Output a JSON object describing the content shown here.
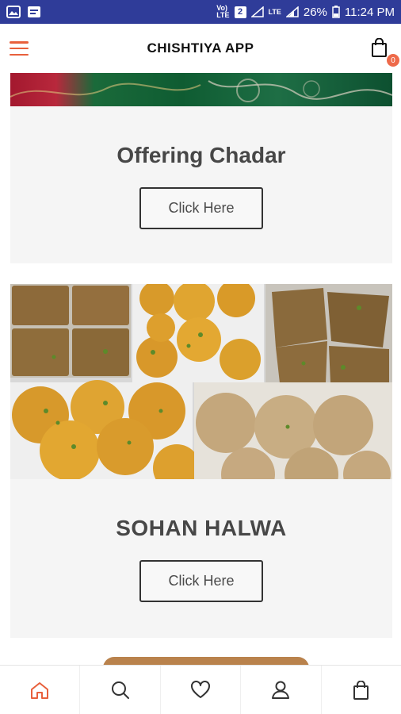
{
  "status_bar": {
    "network_label": "LTE",
    "battery": "26%",
    "time": "11:24 PM",
    "sim_badge": "2"
  },
  "header": {
    "title": "CHISHTIYA APP",
    "cart_count": "0"
  },
  "cards": [
    {
      "title": "Offering Chadar",
      "button": "Click Here"
    },
    {
      "title": "SOHAN HALWA",
      "button": "Click Here"
    }
  ],
  "bottom_nav": [
    "home-icon",
    "search-icon",
    "heart-icon",
    "user-icon",
    "bag-icon"
  ],
  "colors": {
    "status_bar": "#2f3c99",
    "accent": "#e8603c",
    "card_bg": "#f5f5f5",
    "card_title": "#474747"
  }
}
